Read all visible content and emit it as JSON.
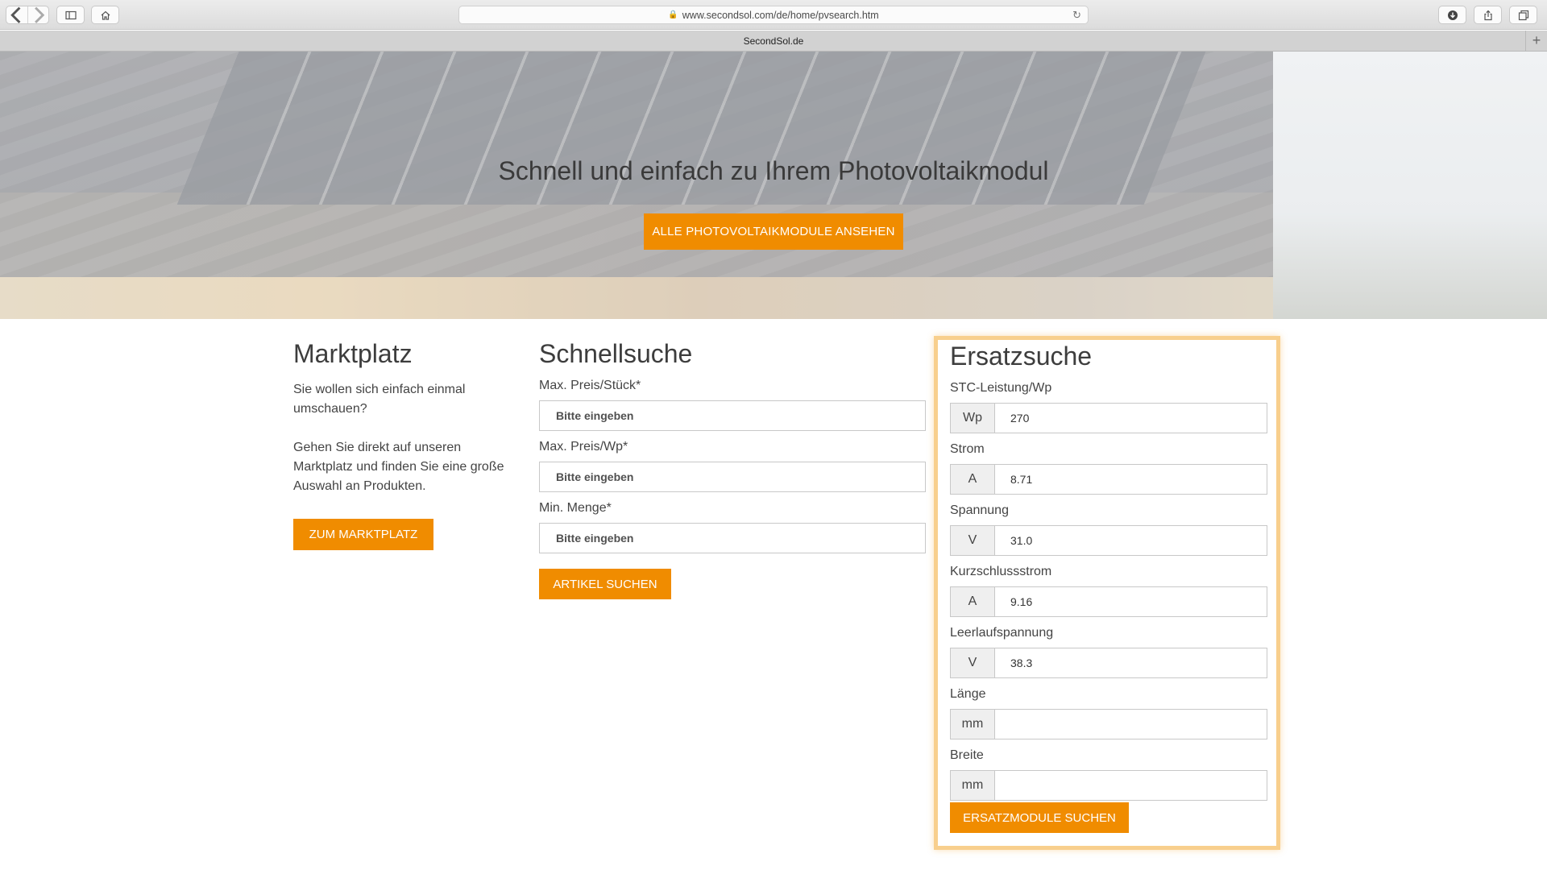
{
  "browser": {
    "url_host": "www.secondsol.com",
    "url_path": "/de/home/pvsearch.htm",
    "tab_title": "SecondSol.de"
  },
  "hero": {
    "title": "Schnell und einfach zu Ihrem Photovoltaikmodul",
    "button": "ALLE PHOTOVOLTAIKMODULE ANSEHEN"
  },
  "marketplace": {
    "title": "Marktplatz",
    "text1": "Sie wollen sich einfach einmal umschauen?",
    "text2": "Gehen Sie direkt auf unseren Marktplatz und finden Sie eine große Auswahl an Produkten.",
    "button": "ZUM MARKTPLATZ"
  },
  "quicksearch": {
    "title": "Schnellsuche",
    "fields": [
      {
        "label": "Max. Preis/Stück*",
        "placeholder": "Bitte eingeben"
      },
      {
        "label": "Max. Preis/Wp*",
        "placeholder": "Bitte eingeben"
      },
      {
        "label": "Min. Menge*",
        "placeholder": "Bitte eingeben"
      }
    ],
    "button": "ARTIKEL SUCHEN"
  },
  "replacement": {
    "title": "Ersatzsuche",
    "fields": [
      {
        "label": "STC-Leistung/Wp",
        "unit": "Wp",
        "value": "270"
      },
      {
        "label": "Strom",
        "unit": "A",
        "value": "8.71"
      },
      {
        "label": "Spannung",
        "unit": "V",
        "value": "31.0"
      },
      {
        "label": "Kurzschlussstrom",
        "unit": "A",
        "value": "9.16"
      },
      {
        "label": "Leerlaufspannung",
        "unit": "V",
        "value": "38.3"
      },
      {
        "label": "Länge",
        "unit": "mm",
        "value": ""
      },
      {
        "label": "Breite",
        "unit": "mm",
        "value": ""
      }
    ],
    "button": "ERSATZMODULE SUCHEN"
  },
  "colors": {
    "accent": "#f08c00",
    "highlight_border": "#f8cf8d"
  }
}
